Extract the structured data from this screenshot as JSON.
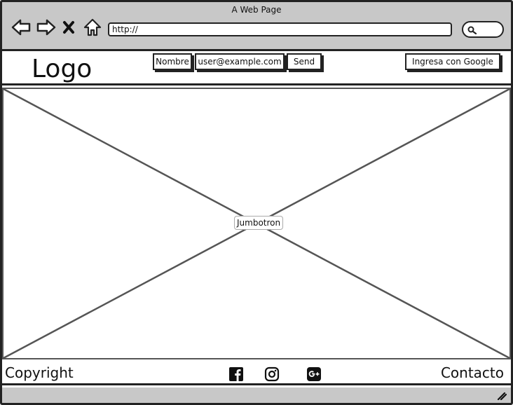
{
  "window": {
    "title": "A Web Page",
    "url": "http://"
  },
  "header": {
    "logo": "Logo",
    "name_button": "Nombre",
    "email_field": "user@example.com",
    "send_button": "Send",
    "google_button": "Ingresa con Google"
  },
  "main": {
    "jumbotron_label": "Jumbotron"
  },
  "footer": {
    "copyright": "Copyright",
    "contact": "Contacto",
    "social_icons": [
      "facebook-icon",
      "instagram-icon",
      "google-plus-icon"
    ]
  },
  "colors": {
    "chrome": "#c8c8c8",
    "stroke": "#222222",
    "background": "#ffffff"
  }
}
